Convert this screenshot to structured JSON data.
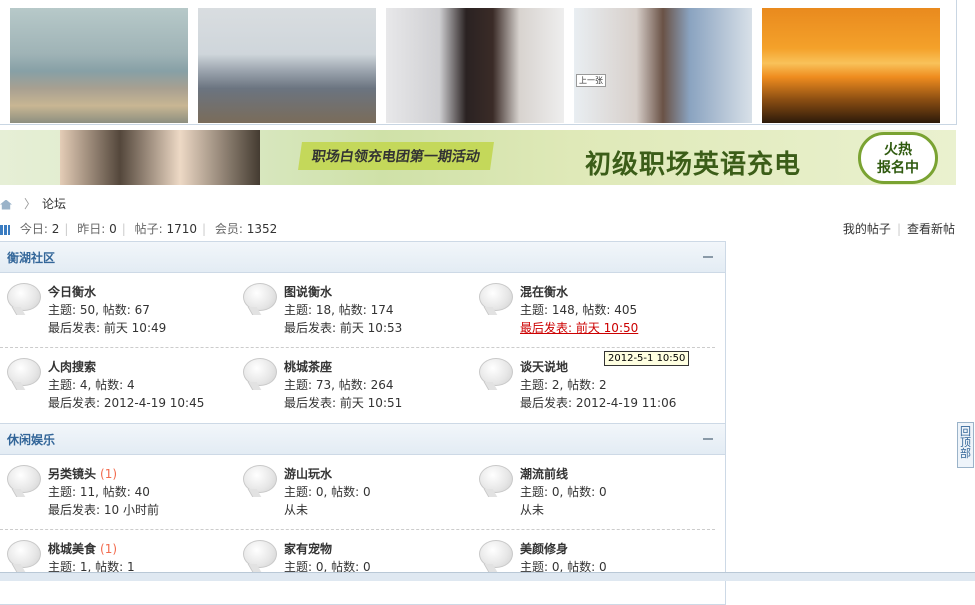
{
  "sections": [
    {
      "title": "衡湖社区",
      "rows": [
        [
          {
            "name": "今日衡水",
            "new": "",
            "meta": "主题: 50, 帖数: 67",
            "last": "最后发表: 前天 10:49"
          },
          {
            "name": "图说衡水",
            "new": "",
            "meta": "主题: 18, 帖数: 174",
            "last": "最后发表: 前天 10:53"
          },
          {
            "name": "混在衡水",
            "new": "",
            "meta": "主题: 148, 帖数: 405",
            "last": "最后发表: 前天 10:50"
          }
        ],
        [
          {
            "name": "人肉搜索",
            "new": "",
            "meta": "主题: 4, 帖数: 4",
            "last": "最后发表: 2012-4-19 10:45"
          },
          {
            "name": "桃城茶座",
            "new": "",
            "meta": "主题: 73, 帖数: 264",
            "last": "最后发表: 前天 10:51"
          },
          {
            "name": "谈天说地",
            "new": "",
            "meta": "主题: 2, 帖数: 2",
            "last": "最后发表: 2012-4-19 11:06"
          }
        ]
      ]
    },
    {
      "title": "休闲娱乐",
      "rows": [
        [
          {
            "name": "另类镜头",
            "new": "(1)",
            "meta": "主题: 11, 帖数: 40",
            "last": "最后发表: 10 小时前"
          },
          {
            "name": "游山玩水",
            "new": "",
            "meta": "主题: 0, 帖数: 0",
            "last": "从未"
          },
          {
            "name": "潮流前线",
            "new": "",
            "meta": "主题: 0, 帖数: 0",
            "last": "从未"
          }
        ],
        [
          {
            "name": "桃城美食",
            "new": "(1)",
            "meta": "主题: 1, 帖数: 1",
            "last": ""
          },
          {
            "name": "家有宠物",
            "new": "",
            "meta": "主题: 0, 帖数: 0",
            "last": ""
          },
          {
            "name": "美颜修身",
            "new": "",
            "meta": "主题: 0, 帖数: 0",
            "last": ""
          }
        ]
      ]
    }
  ],
  "banner": {
    "tag": "职场白领充电团第一期活动",
    "big": "初级职场英语充电",
    "hot": "火热\n报名中"
  },
  "breadcrumb": {
    "current": "论坛"
  },
  "stats": {
    "today_label": "今日:",
    "today": "2",
    "yesterday_label": "昨日:",
    "yesterday": "0",
    "posts_label": "帖子:",
    "posts": "1710",
    "members_label": "会员:",
    "members": "1352"
  },
  "links": {
    "my_posts": "我的帖子",
    "new_posts": "查看新帖"
  },
  "tooltip": "2012-5-1 10:50",
  "backtop": "回\n顶\n部",
  "photo_overlay": "上一张"
}
